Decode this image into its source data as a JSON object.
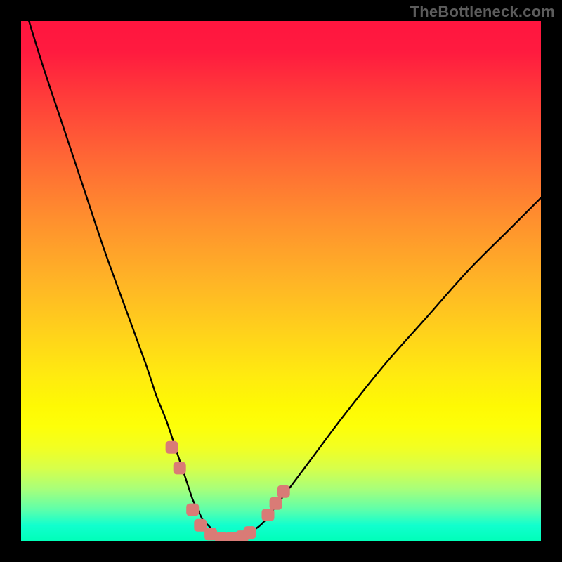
{
  "watermark": "TheBottleneck.com",
  "colors": {
    "frame": "#000000",
    "curve": "#000000",
    "markers": "#d97b76",
    "gradient_top": "#ff153f",
    "gradient_bottom": "#00ffb9"
  },
  "chart_data": {
    "type": "line",
    "title": "",
    "xlabel": "",
    "ylabel": "",
    "xlim": [
      0,
      100
    ],
    "ylim": [
      0,
      100
    ],
    "grid": false,
    "series": [
      {
        "name": "bottleneck-curve",
        "x": [
          0,
          4,
          8,
          12,
          16,
          20,
          24,
          26,
          28,
          30,
          32,
          33,
          34,
          35,
          36,
          37,
          38,
          40,
          42,
          46,
          50,
          56,
          62,
          70,
          78,
          86,
          94,
          100
        ],
        "y": [
          105,
          92,
          80,
          68,
          56,
          45,
          34,
          28,
          23,
          17,
          11,
          8,
          6,
          4,
          3,
          2,
          1.2,
          0.6,
          0.9,
          3,
          8,
          16,
          24,
          34,
          43,
          52,
          60,
          66
        ]
      }
    ],
    "markers": [
      {
        "x": 29.0,
        "y": 18.0
      },
      {
        "x": 30.5,
        "y": 14.0
      },
      {
        "x": 33.0,
        "y": 6.0
      },
      {
        "x": 34.5,
        "y": 3.0
      },
      {
        "x": 36.5,
        "y": 1.3
      },
      {
        "x": 38.5,
        "y": 0.5
      },
      {
        "x": 40.5,
        "y": 0.5
      },
      {
        "x": 42.5,
        "y": 0.8
      },
      {
        "x": 44.0,
        "y": 1.6
      },
      {
        "x": 47.5,
        "y": 5.0
      },
      {
        "x": 49.0,
        "y": 7.2
      },
      {
        "x": 50.5,
        "y": 9.5
      }
    ],
    "marker_radius_px": 9,
    "annotations": []
  }
}
